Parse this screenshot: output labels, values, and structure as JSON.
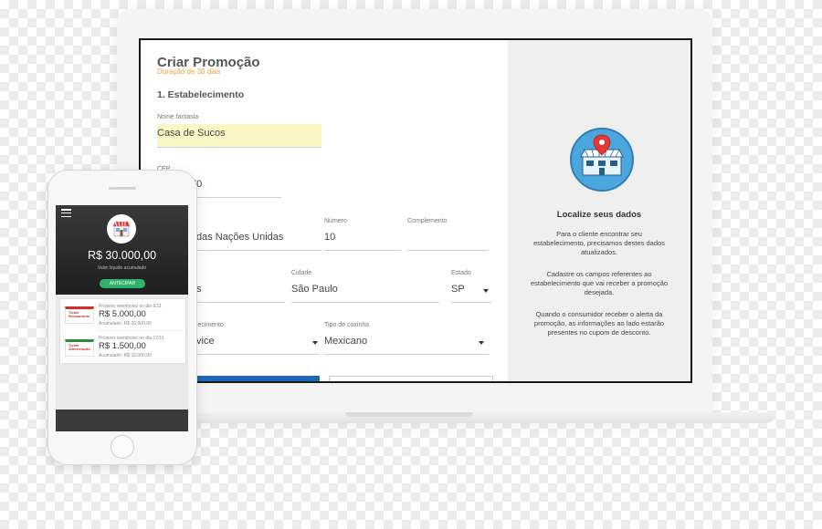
{
  "form": {
    "title": "Criar Promoção",
    "subtitle": "Duração de 30 dias",
    "section": "1. Estabelecimento",
    "fields": {
      "nome_fantasia": {
        "label": "Nome fantasia",
        "value": "Casa de Sucos"
      },
      "cep": {
        "label": "CEP",
        "value": "…70"
      },
      "endereco": {
        "value": "…das Nações Unidas"
      },
      "numero": {
        "label": "Número",
        "value": "10"
      },
      "complemento": {
        "label": "Complemento",
        "value": ""
      },
      "bairro": {
        "value": "…s"
      },
      "cidade": {
        "label": "Cidade",
        "value": "São Paulo"
      },
      "estado": {
        "label": "Estado",
        "value": "SP"
      },
      "tipo_estabelecimento": {
        "label": "…elecimento",
        "value": "…vice"
      },
      "tipo_cozinha": {
        "label": "Tipo de cozinha",
        "value": "Mexicano"
      }
    }
  },
  "side": {
    "title": "Localize seus dados",
    "p1": "Para o cliente encontrar seu estabelecimento, precisamos destes dados atualizados.",
    "p2": "Cadastre os campos referentes ao estabelecimento que vai receber a promoção desejada.",
    "p3": "Quando o consumidor receber o alerta da promoção, as informações ao lado estarão presentes no cupom de desconto.",
    "icon": "store-location-icon",
    "accent": "#4aa6dc"
  },
  "phone": {
    "amount": "R$ 30.000,00",
    "amount_sub": "Valor líquido acumulado",
    "button": "ANTECIPAR",
    "items": [
      {
        "logo": "Ticket Restaurante",
        "next": "Próximo reembolso no dia 6/11",
        "amount": "R$ 5.000,00",
        "accum": "Acumulado: R$ 20.000,00"
      },
      {
        "logo": "Ticket Alimentação",
        "next": "Próximo reembolso no dia 17/11",
        "amount": "R$ 1.500,00",
        "accum": "Acumulado: R$ 10.000,00"
      }
    ]
  }
}
